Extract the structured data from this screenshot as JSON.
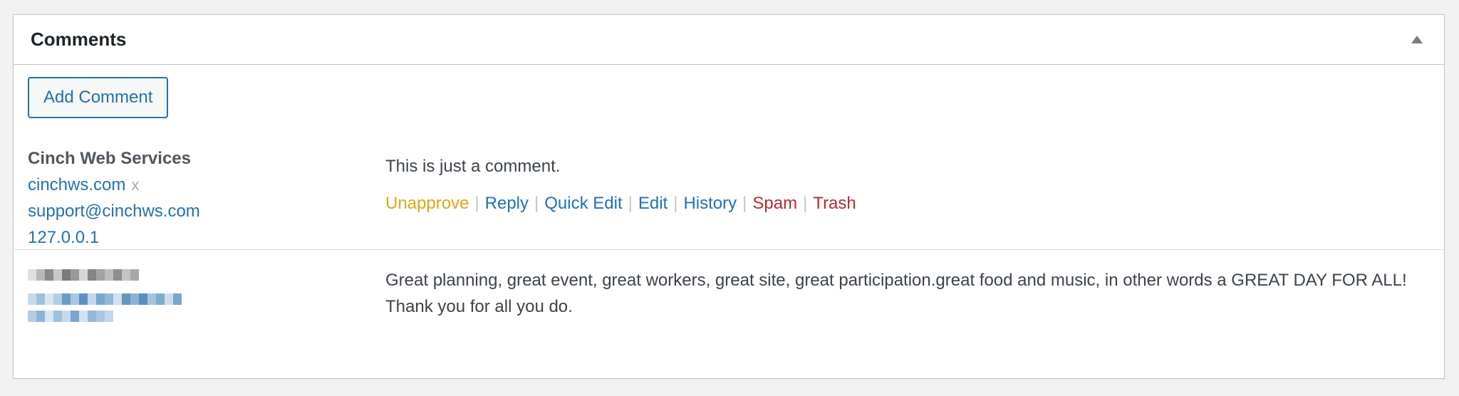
{
  "metabox": {
    "title": "Comments",
    "toggle_icon": "triangle-up-icon"
  },
  "add_comment_label": "Add Comment",
  "comments": [
    {
      "author_name": "Cinch Web Services",
      "author_url": "cinchws.com",
      "remove_label": "x",
      "author_email": "support@cinchws.com",
      "author_ip": "127.0.0.1",
      "text": "This is just a comment.",
      "actions": {
        "unapprove": "Unapprove",
        "reply": "Reply",
        "quick_edit": "Quick Edit",
        "edit": "Edit",
        "history": "History",
        "spam": "Spam",
        "trash": "Trash"
      }
    },
    {
      "author_redacted": true,
      "text": "Great planning, great event, great workers, great site, great participation.great food and music, in other words a GREAT DAY FOR ALL! Thank you for all you do."
    }
  ],
  "colors": {
    "link": "#2271b1",
    "unapprove": "#dba617",
    "destructive": "#b32d2e",
    "separator": "#c3c4c7"
  }
}
